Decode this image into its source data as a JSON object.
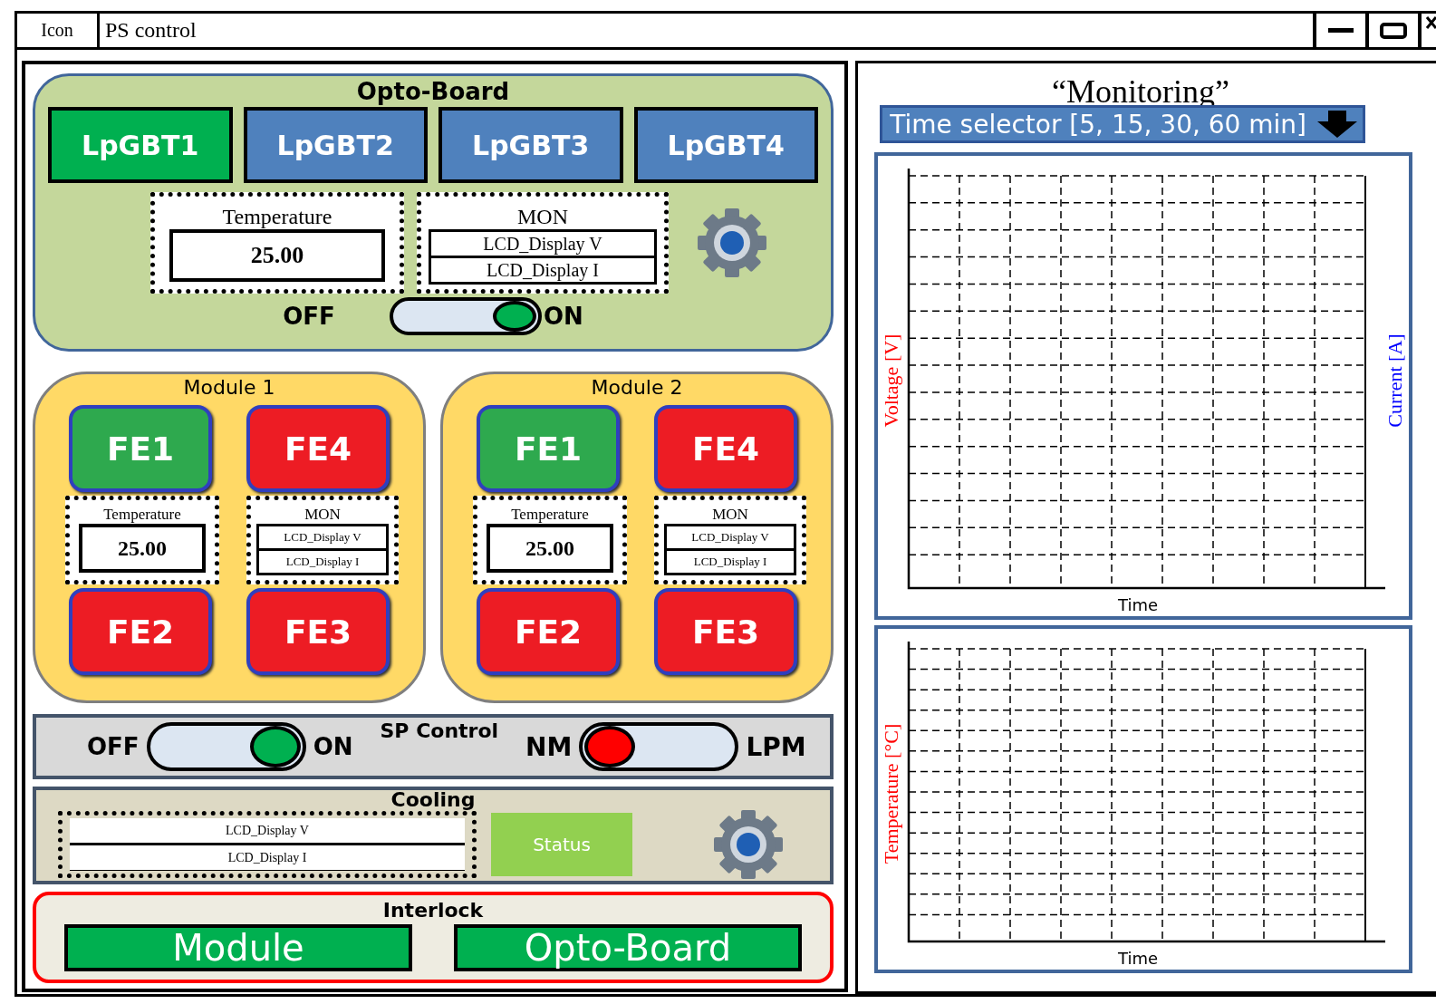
{
  "window": {
    "icon_label": "Icon",
    "title": "PS control"
  },
  "opto_board": {
    "title": "Opto-Board",
    "lpgbts": [
      {
        "label": "LpGBT1",
        "selected": true
      },
      {
        "label": "LpGBT2",
        "selected": false
      },
      {
        "label": "LpGBT3",
        "selected": false
      },
      {
        "label": "LpGBT4",
        "selected": false
      }
    ],
    "temperature": {
      "label": "Temperature",
      "value": "25.00"
    },
    "mon": {
      "label": "MON",
      "displays": [
        "LCD_Display V",
        "LCD_Display I"
      ]
    },
    "power": {
      "off_label": "OFF",
      "on_label": "ON",
      "on": true
    }
  },
  "modules": [
    {
      "title": "Module 1",
      "fes": [
        {
          "label": "FE1",
          "ok": true
        },
        {
          "label": "FE4",
          "ok": false
        },
        {
          "label": "FE2",
          "ok": false
        },
        {
          "label": "FE3",
          "ok": false
        }
      ],
      "temperature": {
        "label": "Temperature",
        "value": "25.00"
      },
      "mon": {
        "label": "MON",
        "displays": [
          "LCD_Display V",
          "LCD_Display I"
        ]
      }
    },
    {
      "title": "Module 2",
      "fes": [
        {
          "label": "FE1",
          "ok": true
        },
        {
          "label": "FE4",
          "ok": false
        },
        {
          "label": "FE2",
          "ok": false
        },
        {
          "label": "FE3",
          "ok": false
        }
      ],
      "temperature": {
        "label": "Temperature",
        "value": "25.00"
      },
      "mon": {
        "label": "MON",
        "displays": [
          "LCD_Display V",
          "LCD_Display I"
        ]
      }
    }
  ],
  "sp_control": {
    "title": "SP Control",
    "power": {
      "off_label": "OFF",
      "on_label": "ON",
      "on": true
    },
    "mode": {
      "left_label": "NM",
      "right_label": "LPM",
      "lpm": false
    }
  },
  "cooling": {
    "title": "Cooling",
    "displays": [
      "LCD_Display V",
      "LCD_Display I"
    ],
    "status_label": "Status"
  },
  "interlock": {
    "title": "Interlock",
    "buttons": [
      {
        "label": "Module",
        "ok": true
      },
      {
        "label": "Opto-Board",
        "ok": true
      }
    ]
  },
  "monitoring": {
    "title": "“Monitoring”",
    "time_selector": "Time selector [5, 15, 30, 60 min]",
    "charts": [
      {
        "ylabel_left": "Voltage [V]",
        "ylabel_right": "Current [A]",
        "xlabel": "Time"
      },
      {
        "ylabel_left": "Temperature [°C]",
        "xlabel": "Time"
      }
    ]
  }
}
